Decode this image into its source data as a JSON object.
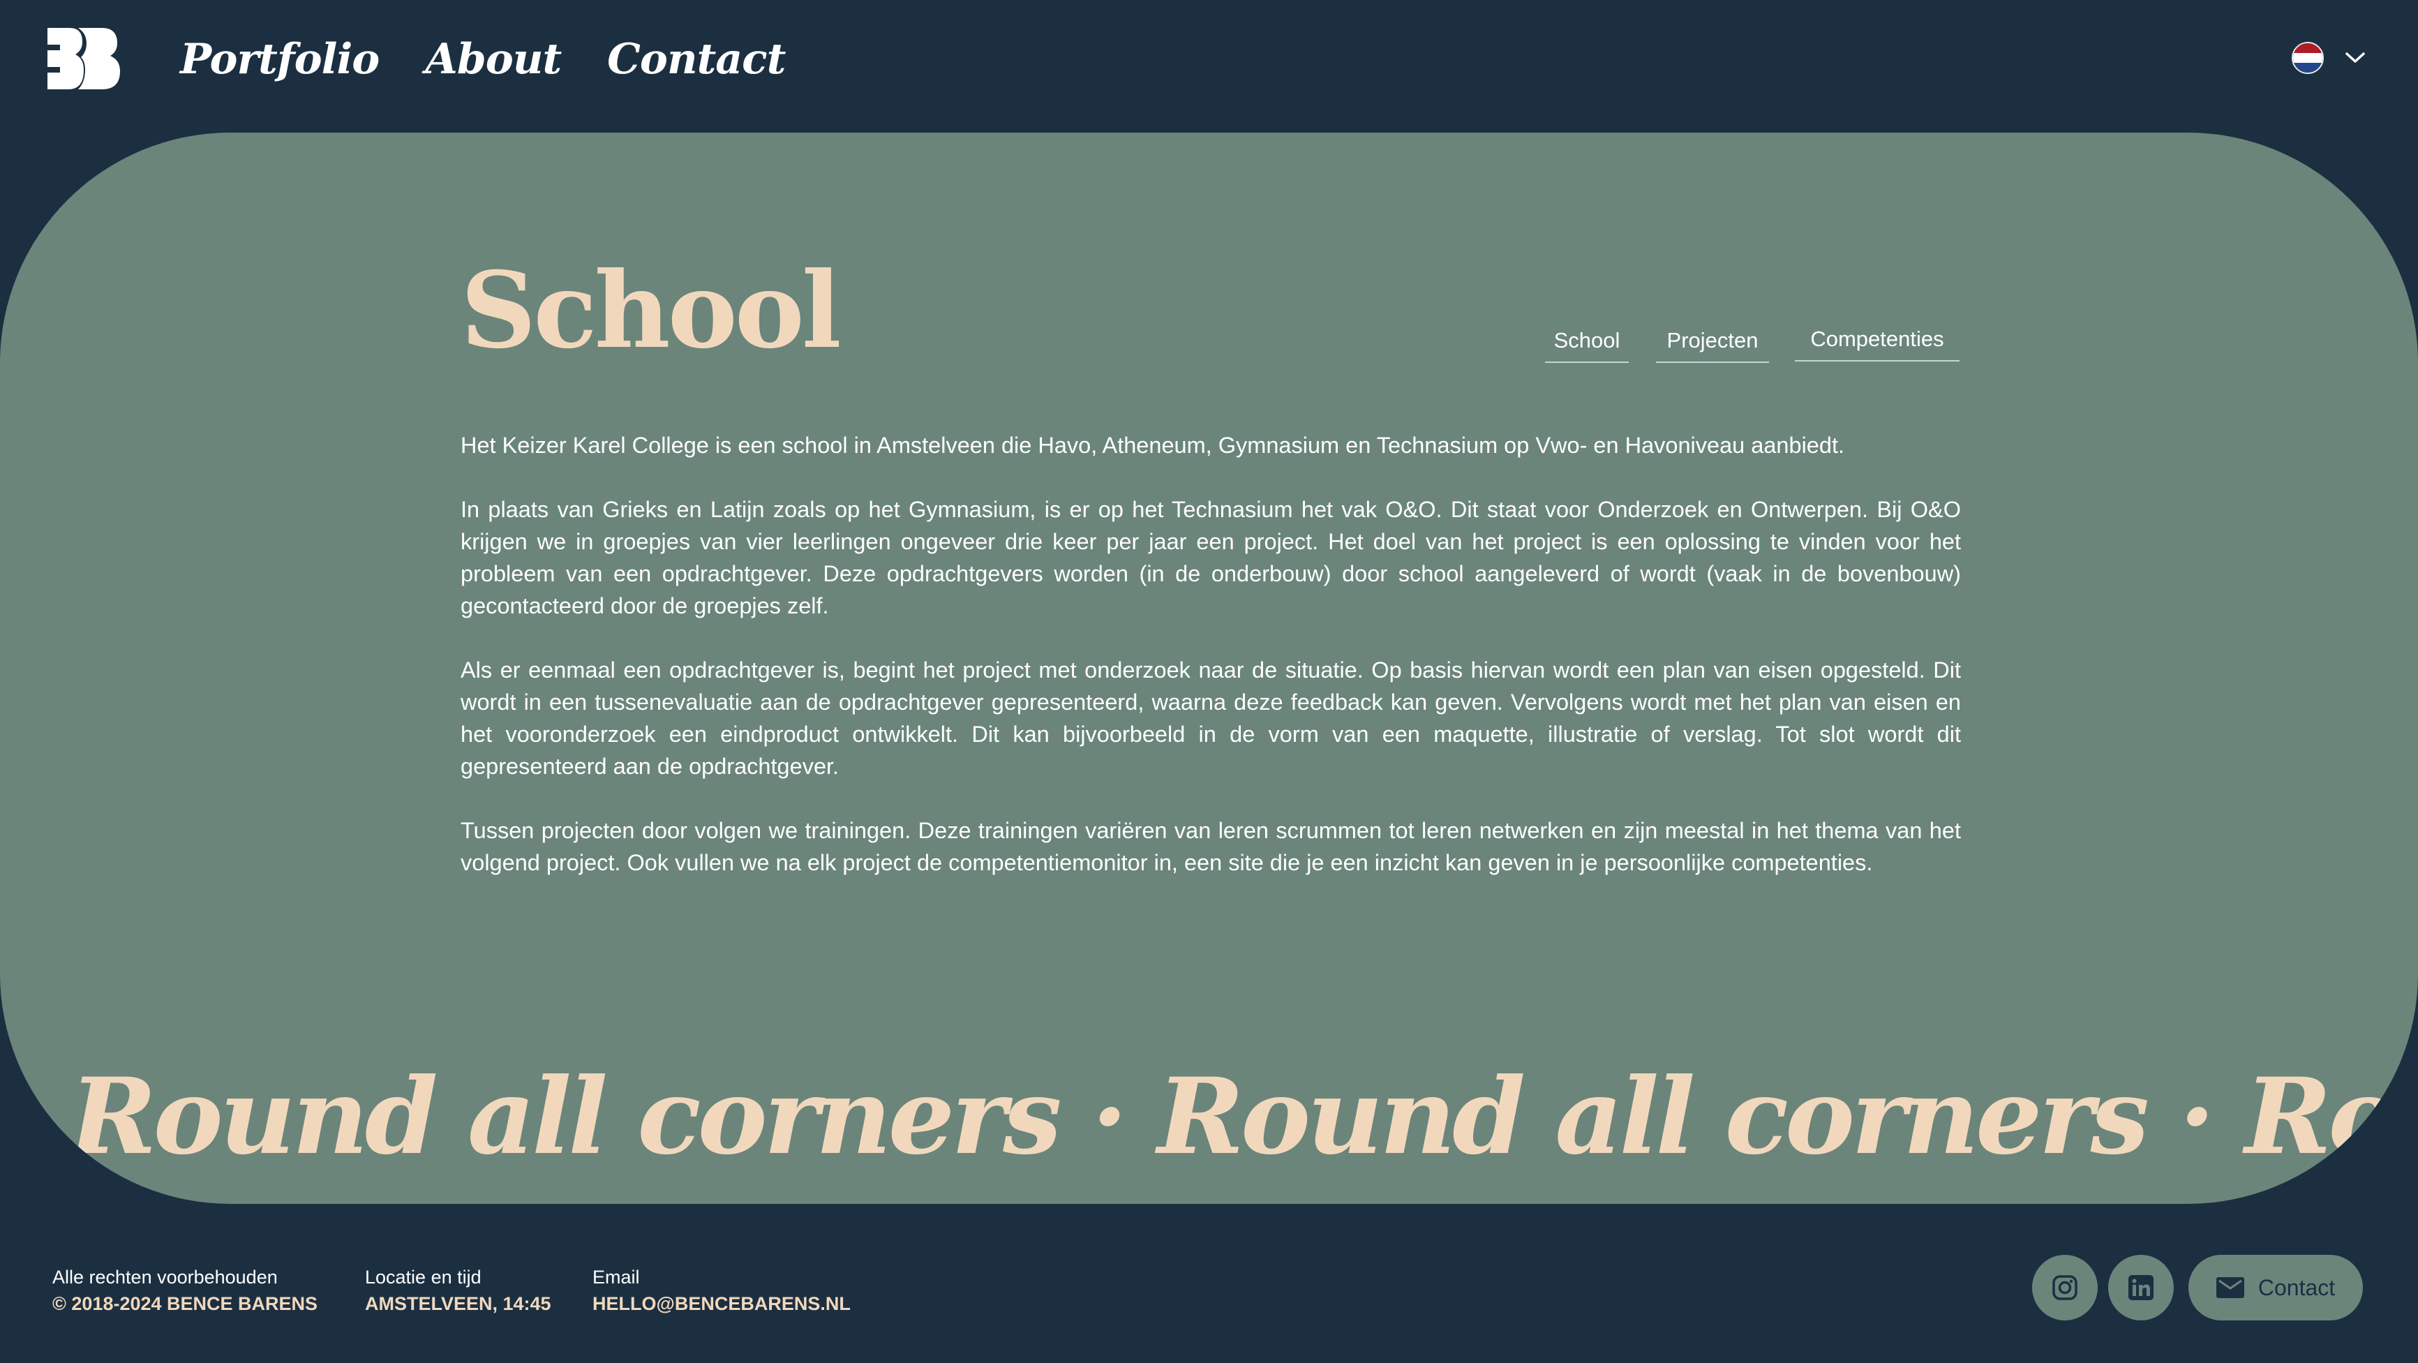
{
  "header": {
    "nav": [
      {
        "label": "Portfolio"
      },
      {
        "label": "About"
      },
      {
        "label": "Contact"
      }
    ],
    "language": {
      "flag_colors": [
        "#ae1c28",
        "#ffffff",
        "#21468b"
      ]
    }
  },
  "main": {
    "title": "School",
    "subnav": [
      {
        "label": "School"
      },
      {
        "label": "Projecten"
      },
      {
        "label": "Competenties"
      }
    ],
    "paragraphs": [
      "Het Keizer Karel College is een school in Amstelveen die Havo, Atheneum, Gymnasium en Technasium op Vwo- en Havoniveau aanbiedt.",
      "In plaats van Grieks en Latijn zoals op het Gymnasium, is er op het Technasium het vak O&O. Dit staat voor Onderzoek en Ontwerpen. Bij O&O krijgen we in groepjes van vier leerlingen ongeveer drie keer per jaar een project. Het doel van het project is een oplossing te vinden voor het probleem van een opdrachtgever. Deze opdrachtgevers worden (in de onderbouw) door school aangeleverd of wordt (vaak in de bovenbouw) gecontacteerd door de groepjes zelf.",
      "Als er eenmaal een opdrachtgever is, begint het project met onderzoek naar de situatie. Op basis hiervan wordt een plan van eisen opgesteld. Dit wordt in een tussenevaluatie aan de opdrachtgever gepresenteerd, waarna deze feedback kan geven. Vervolgens wordt met het plan van eisen en het vooronderzoek een eindproduct ontwikkelt. Dit kan bijvoorbeeld in de vorm van een maquette, illustratie of verslag. Tot slot wordt dit gepresenteerd aan de opdrachtgever.",
      "Tussen projecten door volgen we trainingen. Deze trainingen variëren van leren scrummen tot leren netwerken en zijn meestal in het thema van het volgend project. Ook vullen we na elk project de competentiemonitor in, een site die je een inzicht kan geven in je persoonlijke competenties."
    ],
    "marquee": "Round all corners · Round all corners · Round all corners · Round all corners"
  },
  "footer": {
    "copyright_label": "Alle rechten voorbehouden",
    "copyright_value": "© 2018-2024 BENCE BARENS",
    "location_label": "Locatie en tijd",
    "location_value": "AMSTELVEEN, 14:45",
    "email_label": "Email",
    "email_value": "HELLO@BENCEBARENS.NL",
    "contact_button": "Contact"
  },
  "colors": {
    "background": "#1c2f41",
    "panel": "#6b857b",
    "accent": "#f1d8bd",
    "text": "#ffffff"
  },
  "icons": [
    "logo-icon",
    "flag-nl-icon",
    "chevron-down-icon",
    "instagram-icon",
    "linkedin-icon",
    "mail-icon"
  ]
}
